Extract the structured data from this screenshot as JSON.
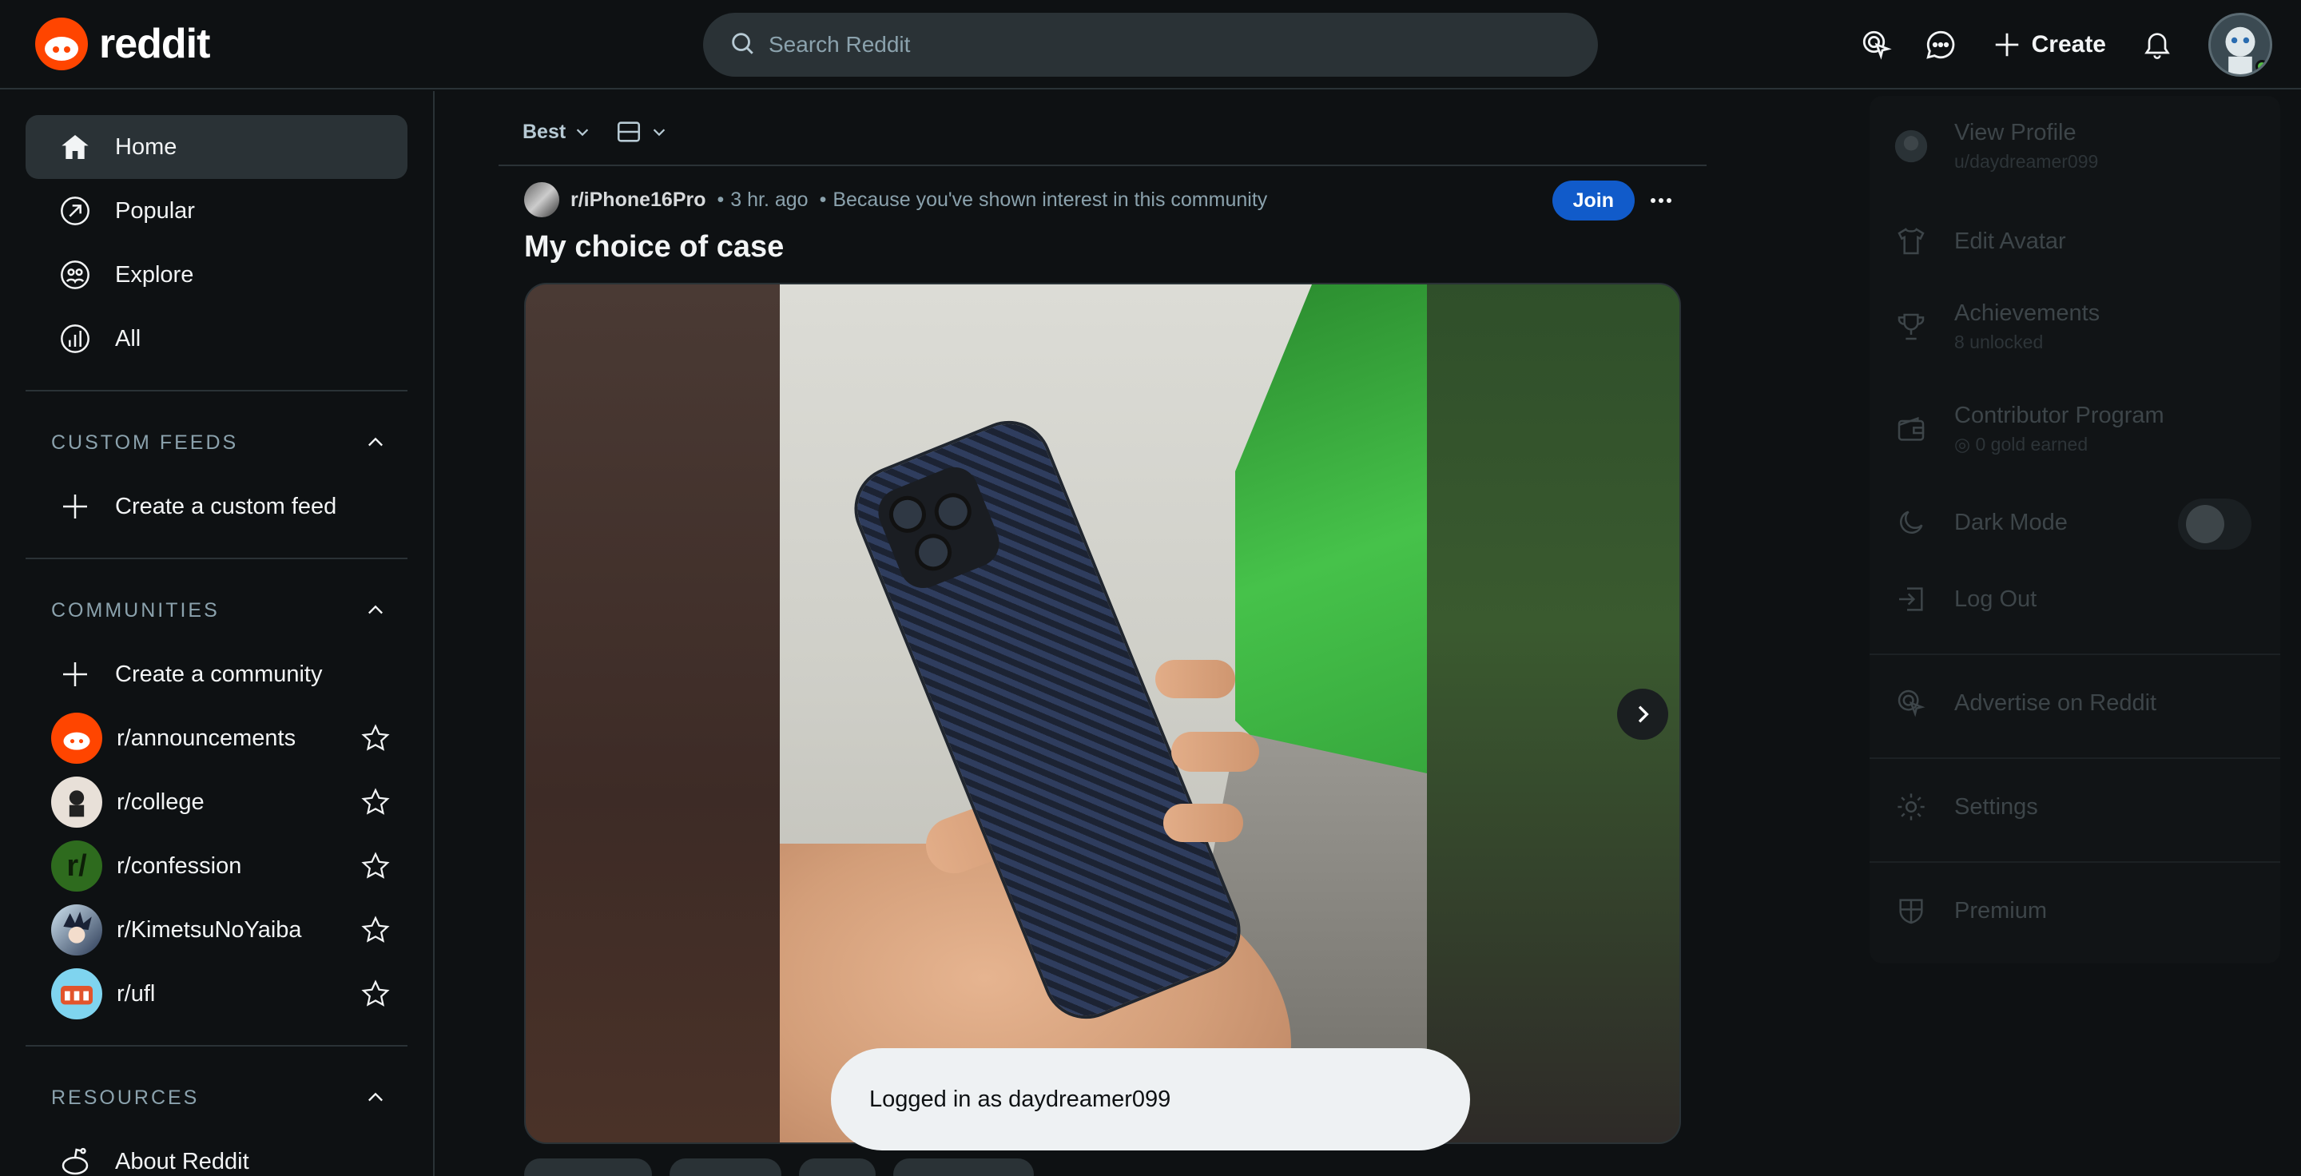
{
  "header": {
    "logo_text": "reddit",
    "search_placeholder": "Search Reddit",
    "create_label": "Create"
  },
  "sidebar": {
    "nav": [
      {
        "label": "Home",
        "icon": "home-icon"
      },
      {
        "label": "Popular",
        "icon": "popular-icon"
      },
      {
        "label": "Explore",
        "icon": "explore-icon"
      },
      {
        "label": "All",
        "icon": "all-icon"
      }
    ],
    "custom_feeds_heading": "CUSTOM FEEDS",
    "create_custom_feed": "Create a custom feed",
    "communities_heading": "COMMUNITIES",
    "create_community": "Create a community",
    "communities": [
      {
        "name": "r/announcements",
        "color": "#ff4500"
      },
      {
        "name": "r/college",
        "color": "#e8e0d8"
      },
      {
        "name": "r/confession",
        "color": "#2e6b1e"
      },
      {
        "name": "r/KimetsuNoYaiba",
        "color": "#3a4a5a"
      },
      {
        "name": "r/ufl",
        "color": "#2aa8d6"
      }
    ],
    "resources_heading": "RESOURCES",
    "about_reddit": "About Reddit"
  },
  "feed": {
    "sort_label": "Best",
    "post": {
      "subreddit": "r/iPhone16Pro",
      "time": "3 hr. ago",
      "reason": "Because you've shown interest in this community",
      "join_label": "Join",
      "title": "My choice of case"
    }
  },
  "toast": {
    "message": "Logged in as daydreamer099"
  },
  "user_menu": {
    "view_profile": "View Profile",
    "username": "u/daydreamer099",
    "edit_avatar": "Edit Avatar",
    "achievements": "Achievements",
    "achievements_sub": "8 unlocked",
    "contributor_program": "Contributor Program",
    "contributor_sub": "0 gold earned",
    "dark_mode": "Dark Mode",
    "log_out": "Log Out",
    "advertise": "Advertise on Reddit",
    "settings": "Settings",
    "premium": "Premium"
  },
  "colors": {
    "brand": "#ff4500",
    "join": "#115bca",
    "background": "#0e1113"
  }
}
